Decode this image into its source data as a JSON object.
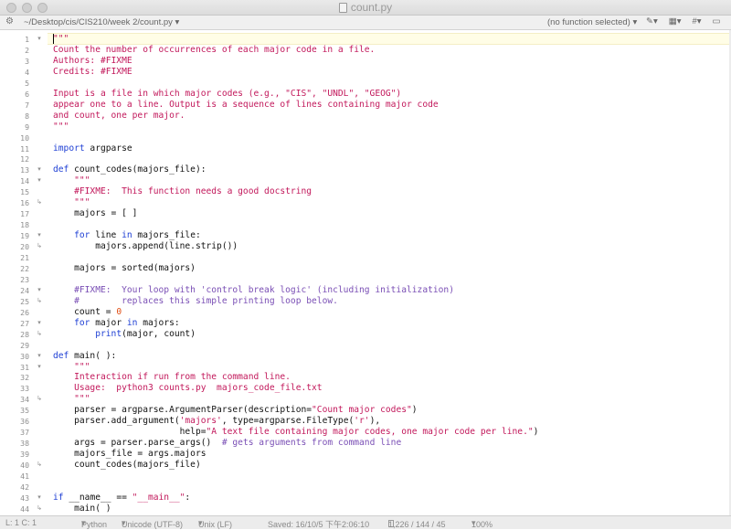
{
  "window": {
    "title": "count.py"
  },
  "navbar": {
    "path": "~/Desktop/cis/CIS210/week 2/count.py",
    "function_menu": "(no function selected)"
  },
  "code_lines": [
    {
      "n": "1",
      "fold": "▾",
      "segs": [
        {
          "t": "\"\"\"",
          "c": "str"
        }
      ]
    },
    {
      "n": "2",
      "fold": "",
      "segs": [
        {
          "t": "Count the number of occurrences of each major code in a file.",
          "c": "str"
        }
      ]
    },
    {
      "n": "3",
      "fold": "",
      "segs": [
        {
          "t": "Authors: #FIXME",
          "c": "str"
        }
      ]
    },
    {
      "n": "4",
      "fold": "",
      "segs": [
        {
          "t": "Credits: #FIXME",
          "c": "str"
        }
      ]
    },
    {
      "n": "5",
      "fold": "",
      "segs": []
    },
    {
      "n": "6",
      "fold": "",
      "segs": [
        {
          "t": "Input is a file in which major codes (e.g., \"CIS\", \"UNDL\", \"GEOG\")",
          "c": "str"
        }
      ]
    },
    {
      "n": "7",
      "fold": "",
      "segs": [
        {
          "t": "appear one to a line. Output is a sequence of lines containing major code",
          "c": "str"
        }
      ]
    },
    {
      "n": "8",
      "fold": "",
      "segs": [
        {
          "t": "and count, one per major.",
          "c": "str"
        }
      ]
    },
    {
      "n": "9",
      "fold": "",
      "segs": [
        {
          "t": "\"\"\"",
          "c": "str"
        }
      ]
    },
    {
      "n": "10",
      "fold": "",
      "segs": []
    },
    {
      "n": "11",
      "fold": "",
      "segs": [
        {
          "t": "import",
          "c": "kw"
        },
        {
          "t": " argparse",
          "c": ""
        }
      ]
    },
    {
      "n": "12",
      "fold": "",
      "segs": []
    },
    {
      "n": "13",
      "fold": "▾",
      "segs": [
        {
          "t": "def",
          "c": "kw"
        },
        {
          "t": " count_codes(majors_file):",
          "c": ""
        }
      ]
    },
    {
      "n": "14",
      "fold": "▾",
      "segs": [
        {
          "t": "    \"\"\"",
          "c": "str"
        }
      ]
    },
    {
      "n": "15",
      "fold": "",
      "segs": [
        {
          "t": "    #FIXME:  This function needs a good docstring",
          "c": "str"
        }
      ]
    },
    {
      "n": "16",
      "fold": "↳",
      "segs": [
        {
          "t": "    \"\"\"",
          "c": "str"
        }
      ]
    },
    {
      "n": "17",
      "fold": "",
      "segs": [
        {
          "t": "    majors = [ ]",
          "c": ""
        }
      ]
    },
    {
      "n": "18",
      "fold": "",
      "segs": []
    },
    {
      "n": "19",
      "fold": "▾",
      "segs": [
        {
          "t": "    ",
          "c": ""
        },
        {
          "t": "for",
          "c": "kw"
        },
        {
          "t": " line ",
          "c": ""
        },
        {
          "t": "in",
          "c": "kw"
        },
        {
          "t": " majors_file:",
          "c": ""
        }
      ]
    },
    {
      "n": "20",
      "fold": "↳",
      "segs": [
        {
          "t": "        majors.append(line.strip())",
          "c": ""
        }
      ]
    },
    {
      "n": "21",
      "fold": "",
      "segs": []
    },
    {
      "n": "22",
      "fold": "",
      "segs": [
        {
          "t": "    majors = sorted(majors)",
          "c": ""
        }
      ]
    },
    {
      "n": "23",
      "fold": "",
      "segs": []
    },
    {
      "n": "24",
      "fold": "▾",
      "segs": [
        {
          "t": "    #FIXME:  Your loop with 'control break logic' (including initialization)",
          "c": "cmt"
        }
      ]
    },
    {
      "n": "25",
      "fold": "↳",
      "segs": [
        {
          "t": "    #        replaces this simple printing loop below.",
          "c": "cmt"
        }
      ]
    },
    {
      "n": "26",
      "fold": "",
      "segs": [
        {
          "t": "    count = ",
          "c": ""
        },
        {
          "t": "0",
          "c": "num"
        }
      ]
    },
    {
      "n": "27",
      "fold": "▾",
      "segs": [
        {
          "t": "    ",
          "c": ""
        },
        {
          "t": "for",
          "c": "kw"
        },
        {
          "t": " major ",
          "c": ""
        },
        {
          "t": "in",
          "c": "kw"
        },
        {
          "t": " majors:",
          "c": ""
        }
      ]
    },
    {
      "n": "28",
      "fold": "↳",
      "segs": [
        {
          "t": "        ",
          "c": ""
        },
        {
          "t": "print",
          "c": "kw"
        },
        {
          "t": "(major, count)",
          "c": ""
        }
      ]
    },
    {
      "n": "29",
      "fold": "",
      "segs": []
    },
    {
      "n": "30",
      "fold": "▾",
      "segs": [
        {
          "t": "def",
          "c": "kw"
        },
        {
          "t": " main( ):",
          "c": ""
        }
      ]
    },
    {
      "n": "31",
      "fold": "▾",
      "segs": [
        {
          "t": "    \"\"\"",
          "c": "str"
        }
      ]
    },
    {
      "n": "32",
      "fold": "",
      "segs": [
        {
          "t": "    Interaction if run from the command line.",
          "c": "str"
        }
      ]
    },
    {
      "n": "33",
      "fold": "",
      "segs": [
        {
          "t": "    Usage:  python3 counts.py  majors_code_file.txt",
          "c": "str"
        }
      ]
    },
    {
      "n": "34",
      "fold": "↳",
      "segs": [
        {
          "t": "    \"\"\"",
          "c": "str"
        }
      ]
    },
    {
      "n": "35",
      "fold": "",
      "segs": [
        {
          "t": "    parser = argparse.ArgumentParser(description=",
          "c": ""
        },
        {
          "t": "\"Count major codes\"",
          "c": "str"
        },
        {
          "t": ")",
          "c": ""
        }
      ]
    },
    {
      "n": "36",
      "fold": "",
      "segs": [
        {
          "t": "    parser.add_argument(",
          "c": ""
        },
        {
          "t": "'majors'",
          "c": "str"
        },
        {
          "t": ", type=argparse.FileType(",
          "c": ""
        },
        {
          "t": "'r'",
          "c": "str"
        },
        {
          "t": "),",
          "c": ""
        }
      ]
    },
    {
      "n": "37",
      "fold": "",
      "segs": [
        {
          "t": "                        help=",
          "c": ""
        },
        {
          "t": "\"A text file containing major codes, one major code per line.\"",
          "c": "str"
        },
        {
          "t": ")",
          "c": ""
        }
      ]
    },
    {
      "n": "38",
      "fold": "",
      "segs": [
        {
          "t": "    args = parser.parse_args()  ",
          "c": ""
        },
        {
          "t": "# gets arguments from command line",
          "c": "cmt"
        }
      ]
    },
    {
      "n": "39",
      "fold": "",
      "segs": [
        {
          "t": "    majors_file = args.majors",
          "c": ""
        }
      ]
    },
    {
      "n": "40",
      "fold": "↳",
      "segs": [
        {
          "t": "    count_codes(majors_file)",
          "c": ""
        }
      ]
    },
    {
      "n": "41",
      "fold": "",
      "segs": []
    },
    {
      "n": "42",
      "fold": "",
      "segs": []
    },
    {
      "n": "43",
      "fold": "▾",
      "segs": [
        {
          "t": "if",
          "c": "kw"
        },
        {
          "t": " __name__ == ",
          "c": ""
        },
        {
          "t": "\"__main__\"",
          "c": "str"
        },
        {
          "t": ":",
          "c": ""
        }
      ]
    },
    {
      "n": "44",
      "fold": "↳",
      "segs": [
        {
          "t": "    main( )",
          "c": ""
        }
      ]
    }
  ],
  "status": {
    "position": "L: 1 C: 1",
    "language": "Python",
    "encoding": "Unicode (UTF-8)",
    "line_endings": "Unix (LF)",
    "saved": "Saved: 16/10/5 下午2:06:10",
    "stats": "1,226 / 144 / 45",
    "zoom": "100%"
  }
}
